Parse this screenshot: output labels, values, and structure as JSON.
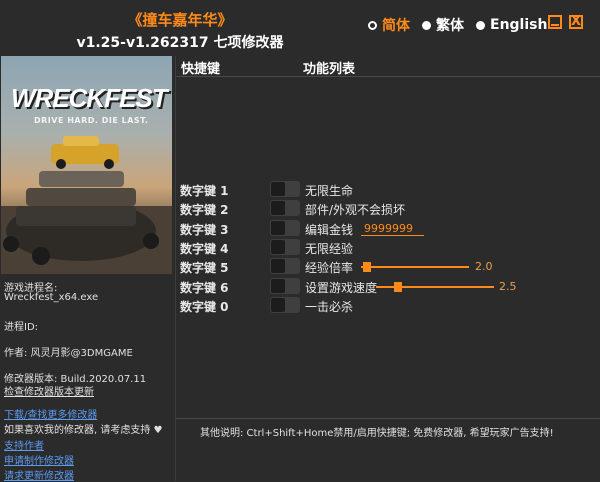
{
  "header": {
    "game_title": "《撞车嘉年华》",
    "subtitle": "v1.25-v1.262317 七项修改器"
  },
  "languages": [
    {
      "label": "简体",
      "active": true
    },
    {
      "label": "繁体",
      "active": false
    },
    {
      "label": "English",
      "active": false
    }
  ],
  "window": {
    "minimize_icon": "minimize-icon",
    "close_label": "X"
  },
  "cover": {
    "logo": "WRECKFEST",
    "tagline": "DRIVE HARD. DIE LAST."
  },
  "columns": {
    "hotkey": "快捷键",
    "function": "功能列表"
  },
  "cheats": [
    {
      "key": "数字键 1",
      "label": "无限生命"
    },
    {
      "key": "数字键 2",
      "label": "部件/外观不会损坏"
    },
    {
      "key": "数字键 3",
      "label": "编辑金钱",
      "value": "9999999"
    },
    {
      "key": "数字键 4",
      "label": "无限经验"
    },
    {
      "key": "数字键 5",
      "label": "经验倍率",
      "slider_value": "2.0",
      "slider_fraction": 0.05
    },
    {
      "key": "数字键 6",
      "label": "设置游戏速度",
      "slider_value": "2.5",
      "slider_fraction": 0.05
    },
    {
      "key": "数字键 0",
      "label": "一击必杀"
    }
  ],
  "sidebar": {
    "process_label": "游戏进程名:",
    "process_name": "Wreckfest_x64.exe",
    "pid_label": "进程ID:",
    "author": "作者: 风灵月影@3DMGAME",
    "version": "修改器版本: Build.2020.07.11",
    "check_update": "检查修改器版本更新",
    "download_more": "下载/查找更多修改器",
    "like_text": "如果喜欢我的修改器, 请考虑支持 ♥",
    "support_author": "支持作者",
    "request_trainer": "申请制作修改器",
    "request_update": "请求更新修改器"
  },
  "footer": {
    "note": "其他说明: Ctrl+Shift+Home禁用/启用快捷键; 免费修改器, 希望玩家广告支持!"
  },
  "colors": {
    "accent": "#ff8a1a",
    "background": "#2b2b2b",
    "link": "#5b9bf0"
  }
}
